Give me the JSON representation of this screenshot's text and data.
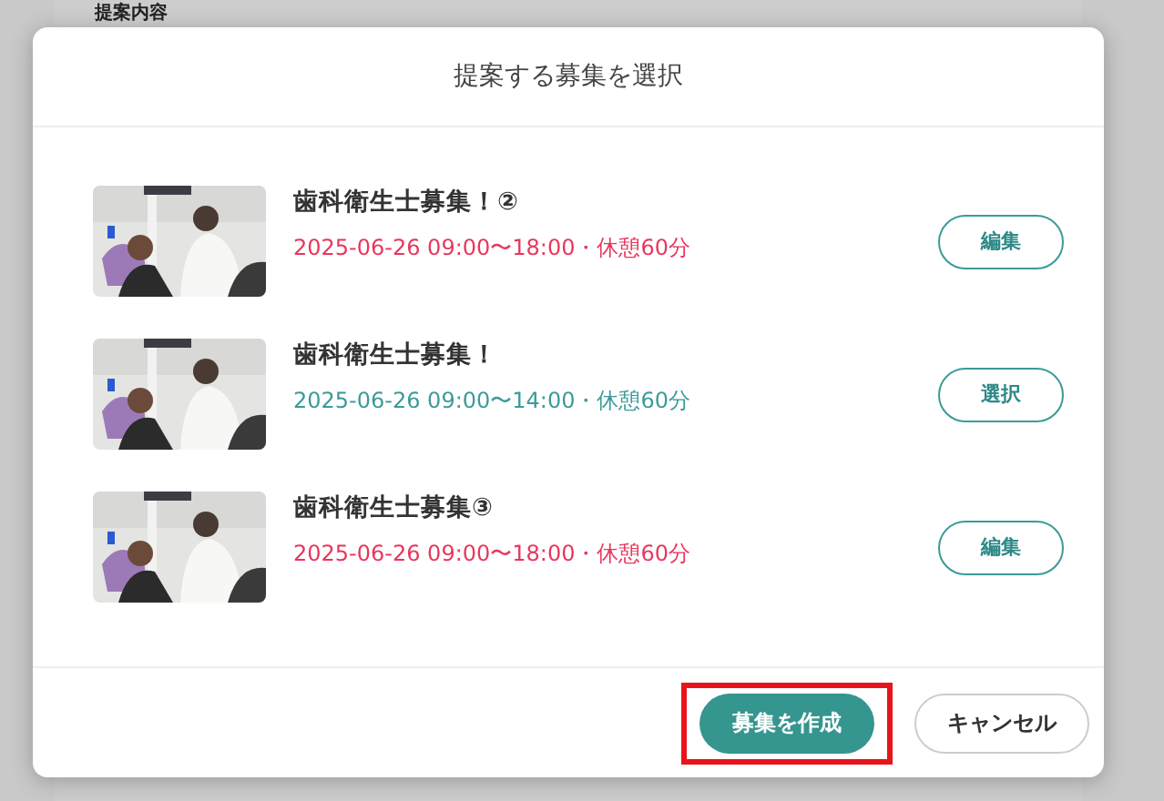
{
  "background_page": {
    "section_title": "提案内容"
  },
  "dialog": {
    "title": "提案する募集を選択",
    "items": [
      {
        "title": "歯科衛生士募集！②",
        "schedule": "2025-06-26 09:00〜18:00・休憩60分",
        "color": "#e8365d",
        "action": "編集"
      },
      {
        "title": "歯科衛生士募集！",
        "schedule": "2025-06-26 09:00〜14:00・休憩60分",
        "color": "#3a9b98",
        "action": "選択"
      },
      {
        "title": "歯科衛生士募集③",
        "schedule": "2025-06-26 09:00〜18:00・休憩60分",
        "color": "#e8365d",
        "action": "編集"
      }
    ],
    "buttons": [
      {
        "kind": "primary",
        "label": "募集を作成",
        "highlighted": true
      },
      {
        "kind": "secondary",
        "label": "キャンセル",
        "highlighted": false
      }
    ]
  }
}
